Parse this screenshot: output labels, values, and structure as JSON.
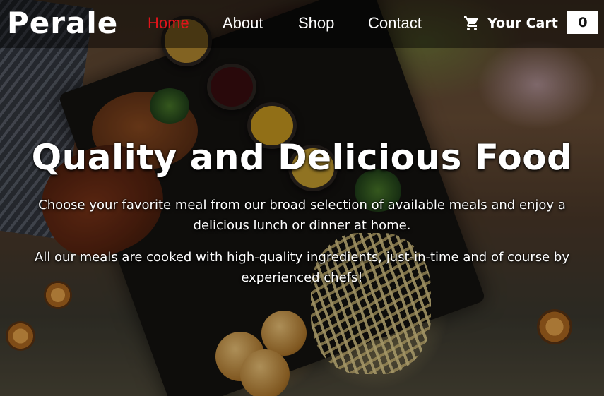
{
  "navbar": {
    "brand": "Perale",
    "links": [
      {
        "label": "Home",
        "active": true
      },
      {
        "label": "About",
        "active": false
      },
      {
        "label": "Shop",
        "active": false
      },
      {
        "label": "Contact",
        "active": false
      }
    ],
    "cart": {
      "icon": "shopping-cart-icon",
      "label": "Your Cart",
      "count": "0"
    },
    "active_color": "#e0141a"
  },
  "hero": {
    "title": "Quality and Delicious Food",
    "paragraph1": "Choose your favorite meal from our broad selection of available meals and enjoy a delicious lunch or dinner at home.",
    "paragraph2": "All our meals are cooked with high-quality ingredients, just-in-time and of course by experienced chefs!"
  }
}
